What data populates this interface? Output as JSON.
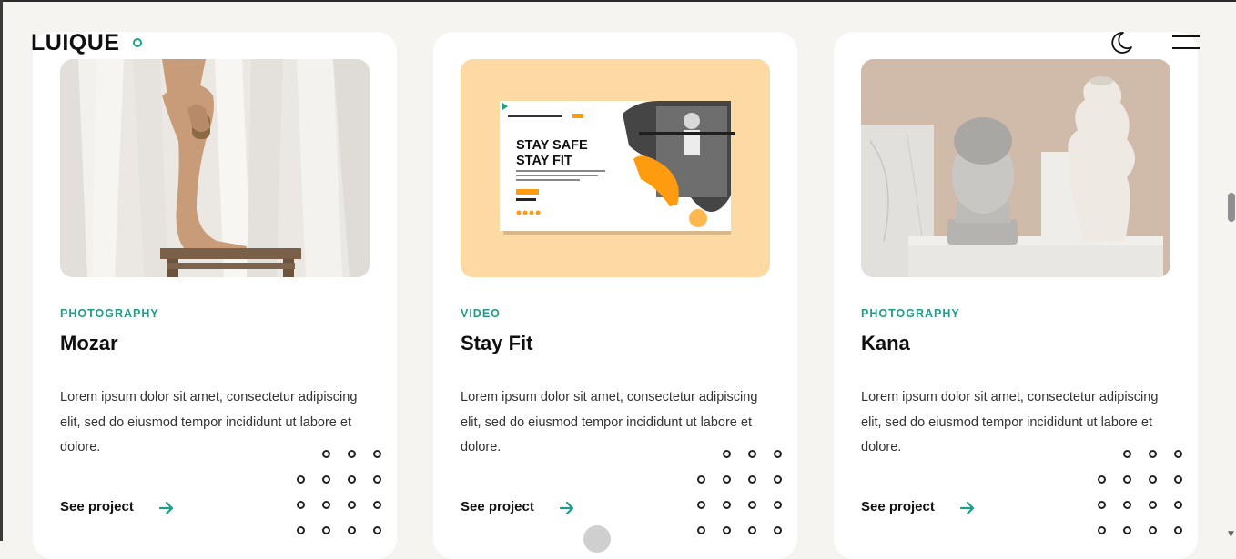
{
  "header": {
    "logo": "LUIQUE",
    "icons": [
      "moon-icon",
      "menu-icon"
    ]
  },
  "cards": [
    {
      "category": "PHOTOGRAPHY",
      "title": "Mozar",
      "description": "Lorem ipsum dolor sit amet, consectetur adipiscing elit, sed do eiusmod tempor incididunt ut labore et dolore.",
      "link_label": "See project"
    },
    {
      "category": "VIDEO",
      "title": "Stay Fit",
      "description": "Lorem ipsum dolor sit amet, consectetur adipiscing elit, sed do eiusmod tempor incididunt ut labore et dolore.",
      "link_label": "See project",
      "image_text": {
        "headline_1": "STAY SAFE",
        "headline_2": "STAY FIT"
      }
    },
    {
      "category": "PHOTOGRAPHY",
      "title": "Kana",
      "description": "Lorem ipsum dolor sit amet, consectetur adipiscing elit, sed do eiusmod tempor incididunt ut labore et dolore.",
      "link_label": "See project"
    }
  ],
  "colors": {
    "accent": "#1e9e8a",
    "page_bg": "#f6f4f1",
    "card_bg": "#ffffff",
    "video_card_bg": "#fdd9a4",
    "stayfit_orange": "#ff9b0f"
  }
}
